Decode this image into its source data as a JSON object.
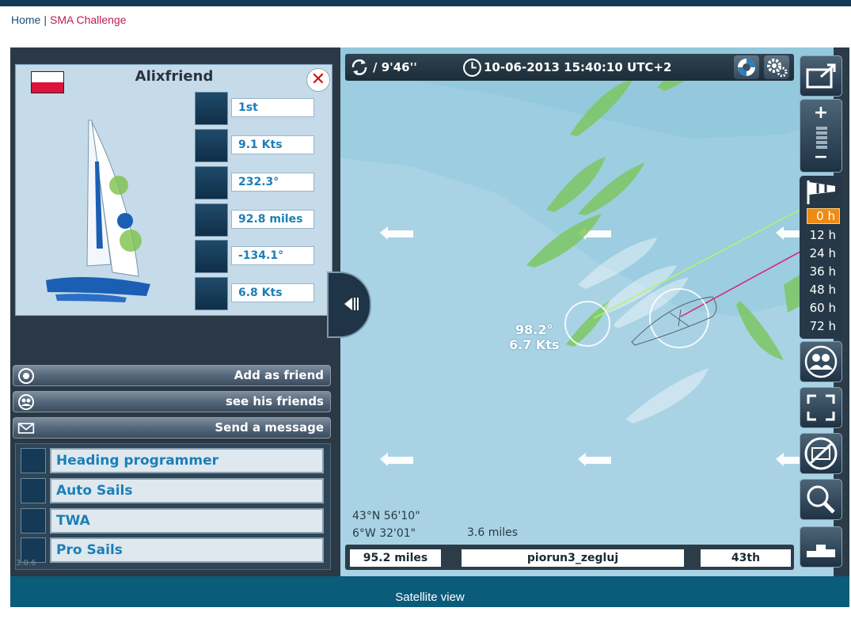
{
  "breadcrumb": {
    "home": "Home",
    "separator": "|",
    "current": "SMA Challenge"
  },
  "player": {
    "name": "Alixfriend",
    "flag": "Poland",
    "stats": {
      "rank": "1st",
      "speed": "9.1 Kts",
      "heading": "232.3°",
      "distance": "92.8 miles",
      "twa": "-134.1°",
      "wind": "6.8 Kts"
    }
  },
  "panel_buttons": {
    "add_friend": "Add as friend",
    "see_friends": "see his friends",
    "send_message": "Send a message"
  },
  "tools": {
    "heading_programmer": "Heading programmer",
    "auto_sails": "Auto Sails",
    "twa": "TWA",
    "pro_sails": "Pro Sails"
  },
  "version": "3.0.6",
  "map_header": {
    "refresh": "/ 9'46''",
    "datetime": "10-06-2013 15:40:10 UTC+2"
  },
  "boat_label": {
    "heading": "98.2°",
    "speed": "6.7 Kts"
  },
  "coords": {
    "lat": "43°N 56'10\"",
    "lon": "6°W 32'01\"",
    "scale": "3.6 miles"
  },
  "map_footer": {
    "distance": "95.2 miles",
    "player": "piorun3_zegluj",
    "rank": "43th"
  },
  "forecast": {
    "hours": [
      "0 h",
      "12 h",
      "24 h",
      "36 h",
      "48 h",
      "60 h",
      "72 h"
    ],
    "selected": "0 h"
  },
  "satellite": "Satellite view",
  "colors": {
    "accent_orange": "#ef8a14",
    "link_blue": "#1b7fb7",
    "breadcrumb_current": "#c2185b",
    "sea": "#a9d3e5"
  }
}
